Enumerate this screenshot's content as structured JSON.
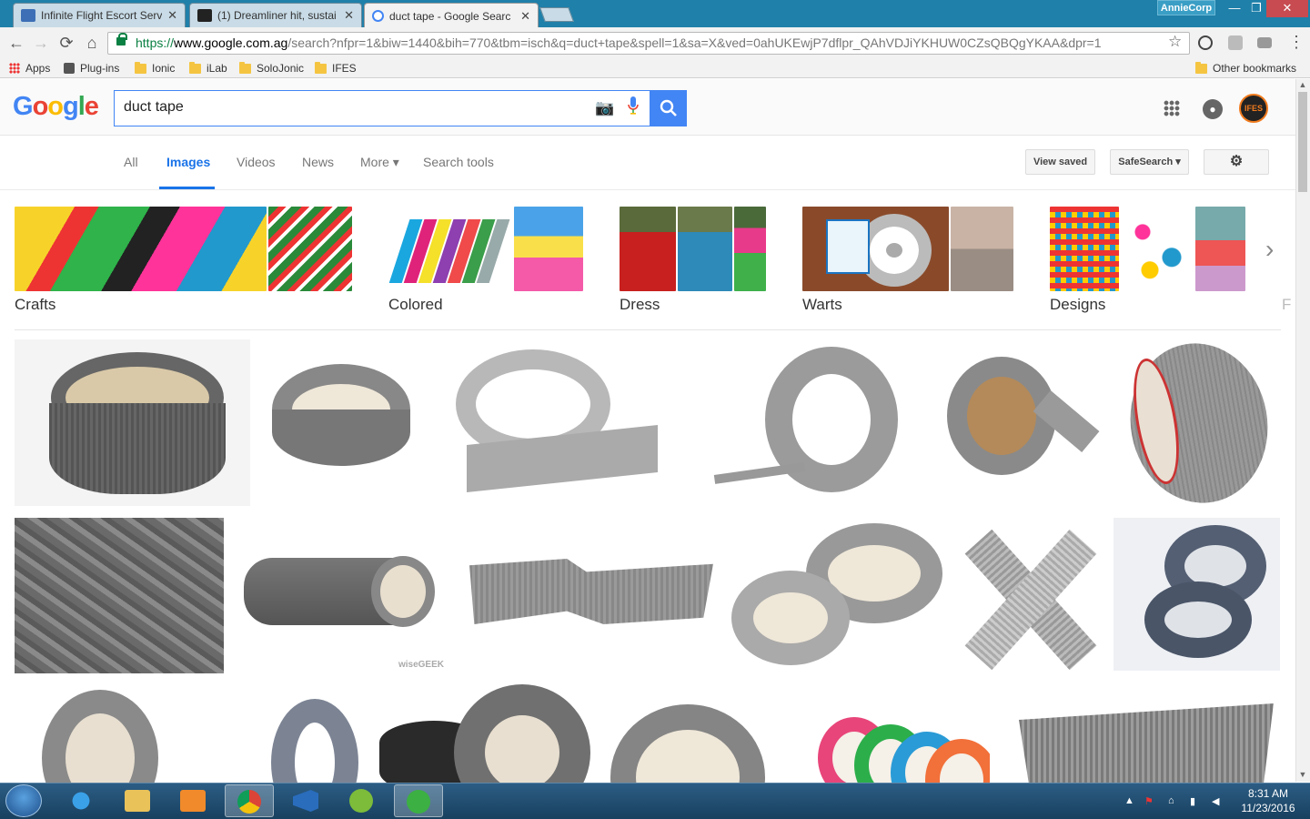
{
  "browser": {
    "tabs": [
      {
        "title": "Infinite Flight Escort Serv",
        "favicon_color": "#3d6fb6",
        "active": false
      },
      {
        "title": "(1) Dreamliner hit, sustai",
        "favicon_color": "#222222",
        "active": false
      },
      {
        "title": "duct tape - Google Searc",
        "favicon_color": "#4285f4",
        "active": true
      }
    ],
    "tab_close": "✕",
    "profile_name": "AnnieCorp",
    "window_controls": {
      "minimize": "—",
      "restore": "❐",
      "close": "✕"
    },
    "url": {
      "scheme": "https://",
      "host": "www.google.com.ag",
      "path": "/search?nfpr=1&biw=1440&bih=770&tbm=isch&q=duct+tape&spell=1&sa=X&ved=0ahUKEwjP7dflpr_QAhVDJiYKHUW0CZsQBQgYKAA&dpr=1"
    },
    "bookmarks": [
      {
        "label": "Apps",
        "icon": "apps-grid-icon"
      },
      {
        "label": "Plug-ins",
        "icon": "puzzle-icon"
      },
      {
        "label": "Ionic",
        "icon": "folder-icon"
      },
      {
        "label": "iLab",
        "icon": "folder-icon"
      },
      {
        "label": "SoloJonic",
        "icon": "folder-icon"
      },
      {
        "label": "IFES",
        "icon": "folder-icon"
      }
    ],
    "other_bookmarks": "Other bookmarks"
  },
  "google": {
    "logo_letters": [
      {
        "ch": "G",
        "color": "#4285f4"
      },
      {
        "ch": "o",
        "color": "#ea4335"
      },
      {
        "ch": "o",
        "color": "#fbbc05"
      },
      {
        "ch": "g",
        "color": "#4285f4"
      },
      {
        "ch": "l",
        "color": "#34a853"
      },
      {
        "ch": "e",
        "color": "#ea4335"
      }
    ],
    "query": "duct tape",
    "avatar_text": "IFES",
    "tabs": [
      "All",
      "Images",
      "Videos",
      "News",
      "More ▾",
      "Search tools"
    ],
    "active_tab": "Images",
    "view_saved": "View saved",
    "safesearch": "SafeSearch ▾",
    "settings_icon": "gear-icon"
  },
  "related": [
    {
      "label": "Crafts"
    },
    {
      "label": "Colored"
    },
    {
      "label": "Dress"
    },
    {
      "label": "Warts"
    },
    {
      "label": "Designs"
    },
    {
      "label": "F"
    }
  ],
  "results": {
    "watermark": "wiseGEEK"
  },
  "taskbar": {
    "time": "8:31 AM",
    "date": "11/23/2016",
    "apps": [
      "internet-explorer-icon",
      "file-explorer-icon",
      "media-player-icon",
      "chrome-icon",
      "visual-studio-icon",
      "android-icon",
      "utorrent-icon"
    ]
  },
  "colors": {
    "accent": "#4285f4",
    "titlebar": "#1f80a9",
    "active_tab_text": "#1a73e8"
  }
}
